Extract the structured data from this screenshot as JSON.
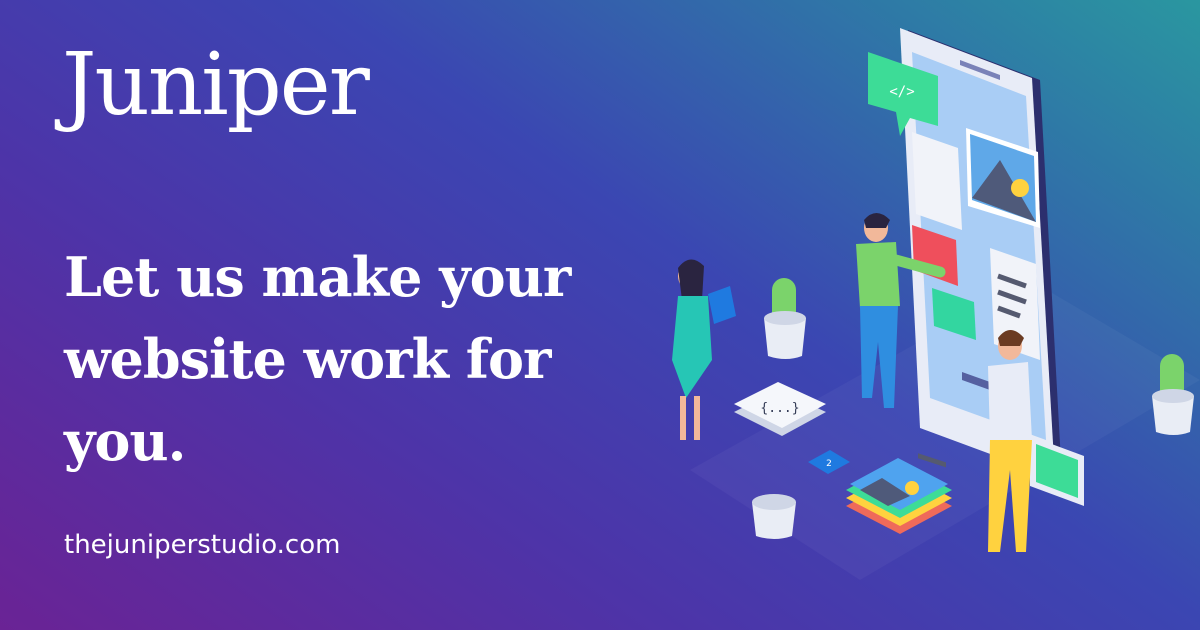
{
  "brand": {
    "name": "Juniper"
  },
  "hero": {
    "headline": "Let us make your website work for you."
  },
  "footer": {
    "url": "thejuniperstudio.com"
  },
  "illustration": {
    "code_bubble_text": "</>",
    "json_card_text": "{...}",
    "badge_text": "2"
  },
  "colors": {
    "gradient_start": "#6a2395",
    "gradient_mid": "#3b46b2",
    "gradient_end": "#2a97a0",
    "accent_green": "#3ddc97",
    "text": "#ffffff"
  }
}
